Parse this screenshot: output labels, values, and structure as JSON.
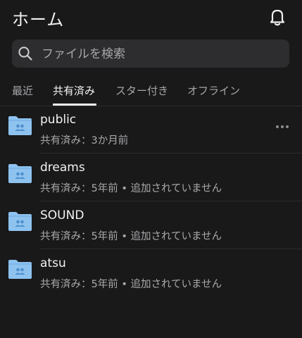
{
  "header": {
    "title": "ホーム",
    "icon": "bell-icon"
  },
  "search": {
    "placeholder": "ファイルを検索",
    "value": "",
    "icon": "search-icon"
  },
  "tabs": [
    {
      "label": "最近",
      "active": false
    },
    {
      "label": "共有済み",
      "active": true
    },
    {
      "label": "スター付き",
      "active": false
    },
    {
      "label": "オフライン",
      "active": false
    }
  ],
  "items": [
    {
      "name": "public",
      "meta": "共有済み：3か月前",
      "icon": "shared-folder-icon",
      "has_more": true
    },
    {
      "name": "dreams",
      "meta": "共有済み：5年前 • 追加されていません",
      "icon": "shared-folder-icon"
    },
    {
      "name": "SOUND",
      "meta": "共有済み：5年前 • 追加されていません",
      "icon": "shared-folder-icon"
    },
    {
      "name": "atsu",
      "meta": "共有済み：5年前 • 追加されていません",
      "icon": "shared-folder-icon"
    }
  ],
  "colors": {
    "background": "#1a191a",
    "folder": "#8ec3f0",
    "folder_dark": "#5d9ad4",
    "search_bg": "#2d2c2e"
  }
}
